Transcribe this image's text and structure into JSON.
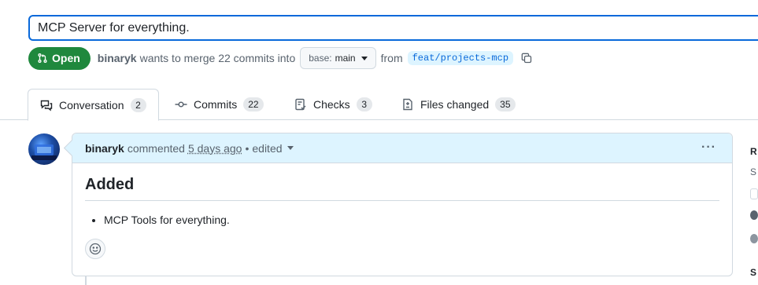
{
  "pr": {
    "title": "MCP Server for everything.",
    "state": "Open",
    "author": "binaryk",
    "merge_text": "wants to merge 22 commits into",
    "base_label": "base:",
    "base_branch": "main",
    "from_text": "from",
    "head_branch": "feat/projects-mcp"
  },
  "tabs": [
    {
      "label": "Conversation",
      "count": "2",
      "icon": "comment-discussion-icon"
    },
    {
      "label": "Commits",
      "count": "22",
      "icon": "git-commit-icon"
    },
    {
      "label": "Checks",
      "count": "3",
      "icon": "checklist-icon"
    },
    {
      "label": "Files changed",
      "count": "35",
      "icon": "file-diff-icon"
    }
  ],
  "comment": {
    "author": "binaryk",
    "action": "commented",
    "time": "5 days ago",
    "separator": "•",
    "edited": "edited",
    "heading": "Added",
    "items": [
      "MCP Tools for everything."
    ]
  },
  "sidebar": {
    "letters": [
      "R",
      "S",
      "S"
    ]
  },
  "colors": {
    "accent": "#0969da",
    "open_green": "#1f883d",
    "comment_header_bg": "#ddf4ff"
  }
}
